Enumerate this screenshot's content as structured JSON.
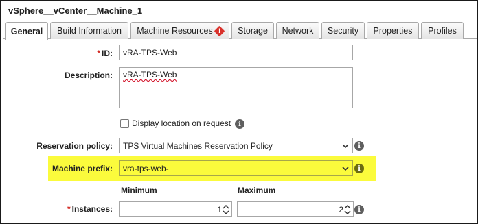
{
  "window": {
    "title": "vSphere__vCenter__Machine_1"
  },
  "tabs": [
    {
      "label": "General",
      "active": true
    },
    {
      "label": "Build Information"
    },
    {
      "label": "Machine Resources",
      "warning": true
    },
    {
      "label": "Storage"
    },
    {
      "label": "Network"
    },
    {
      "label": "Security"
    },
    {
      "label": "Properties"
    },
    {
      "label": "Profiles"
    }
  ],
  "form": {
    "required_marker": "*",
    "id_label": "ID:",
    "id_value": "vRA-TPS-Web",
    "description_label": "Description:",
    "description_value": "vRA-TPS-Web",
    "display_location_label": "Display location on request",
    "display_location_checked": false,
    "reservation_policy_label": "Reservation policy:",
    "reservation_policy_value": "TPS Virtual Machines Reservation Policy",
    "machine_prefix_label": "Machine prefix:",
    "machine_prefix_value": "vra-tps-web-",
    "minimum_header": "Minimum",
    "maximum_header": "Maximum",
    "instances_label": "Instances:",
    "instances_min": "1",
    "instances_max": "2"
  },
  "colors": {
    "highlight": "#fbfb3c",
    "required": "#d2261f",
    "warning": "#d9312b",
    "info": "#5f5f5f"
  },
  "icons": [
    "warning-icon",
    "info-icon",
    "chevron-down-icon",
    "spinner-arrows-icon"
  ]
}
